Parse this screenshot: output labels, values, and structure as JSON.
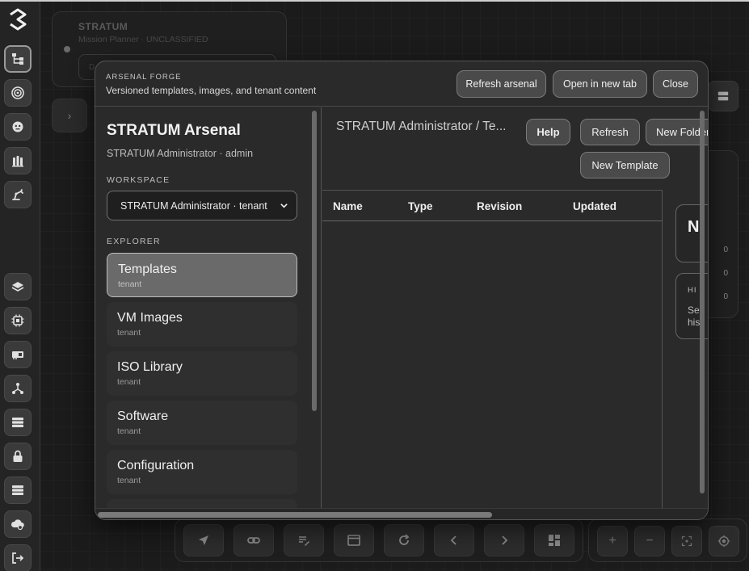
{
  "background": {
    "mission_card": {
      "title": "STRATUM",
      "subtitle": "Mission Planner · UNCLASSIFIED",
      "pill_text": "D"
    },
    "right_panel_counts": [
      "0",
      "0",
      "0"
    ]
  },
  "modal": {
    "kicker": "ARSENAL FORGE",
    "subtitle": "Versioned templates, images, and tenant content",
    "buttons": {
      "refresh_arsenal": "Refresh arsenal",
      "open_new_tab": "Open in new tab",
      "close": "Close"
    },
    "sidebar": {
      "title": "STRATUM Arsenal",
      "user": "STRATUM Administrator · admin",
      "workspace_label": "WORKSPACE",
      "workspace_value": "STRATUM Administrator · tenant",
      "explorer_label": "EXPLORER",
      "items": [
        {
          "label": "Templates",
          "sub": "tenant"
        },
        {
          "label": "VM Images",
          "sub": "tenant"
        },
        {
          "label": "ISO Library",
          "sub": "tenant"
        },
        {
          "label": "Software",
          "sub": "tenant"
        },
        {
          "label": "Configuration",
          "sub": "tenant"
        }
      ]
    },
    "main": {
      "breadcrumb": "STRATUM Administrator / Te...",
      "actions": {
        "help": "Help",
        "refresh": "Refresh",
        "new_folder": "New Folder",
        "new_template": "New Template"
      },
      "table": {
        "columns": [
          "Name",
          "Type",
          "Revision",
          "Updated"
        ]
      },
      "side_card": {
        "initial": "N",
        "history_label": "HI",
        "history_text_1": "Se",
        "history_text_2": "his"
      }
    }
  }
}
